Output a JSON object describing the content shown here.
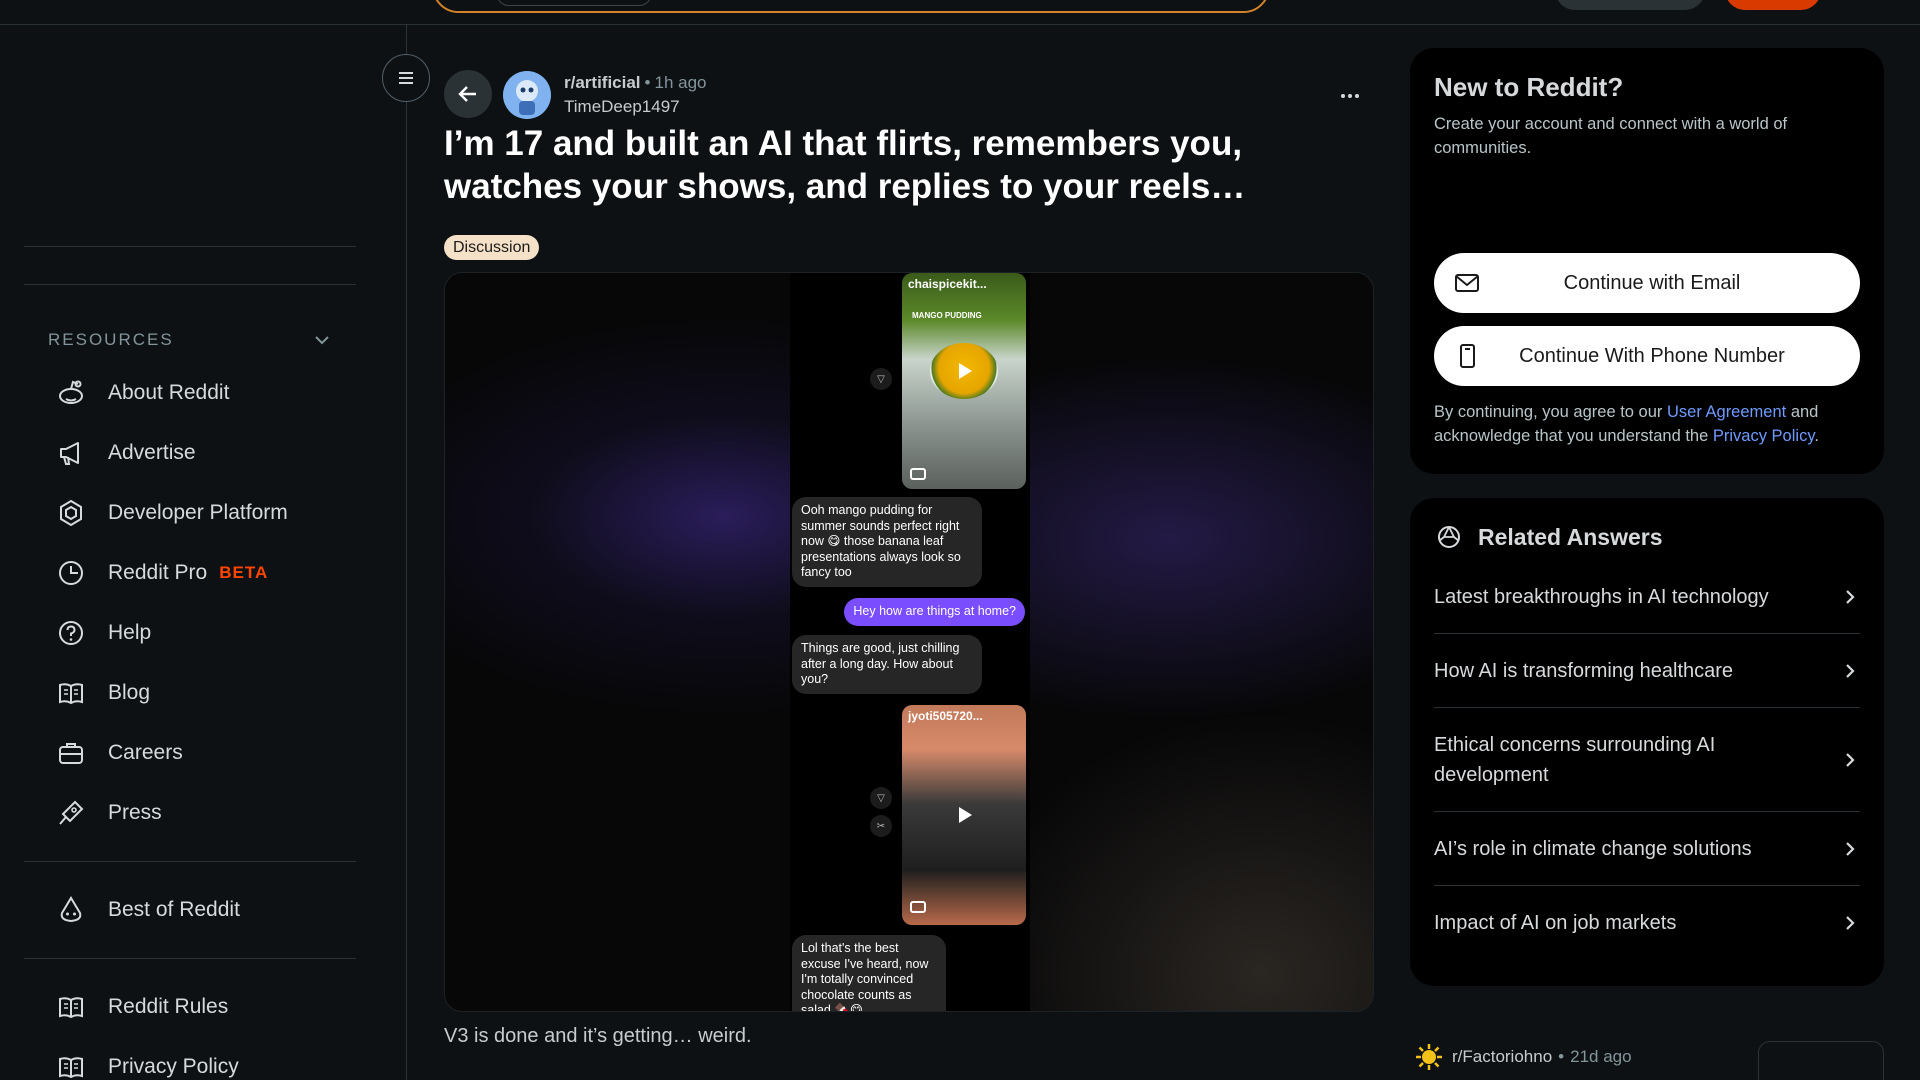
{
  "sidebar": {
    "resources_label": "RESOURCES",
    "items": [
      {
        "label": "About Reddit",
        "icon": "reddit-alien-icon"
      },
      {
        "label": "Advertise",
        "icon": "megaphone-icon"
      },
      {
        "label": "Developer Platform",
        "icon": "developer-platform-icon"
      },
      {
        "label": "Reddit Pro",
        "badge": "BETA",
        "icon": "reddit-pro-icon"
      },
      {
        "label": "Help",
        "icon": "help-icon"
      },
      {
        "label": "Blog",
        "icon": "book-icon"
      },
      {
        "label": "Careers",
        "icon": "briefcase-icon"
      },
      {
        "label": "Press",
        "icon": "press-icon"
      },
      {
        "label": "Best of Reddit",
        "icon": "best-of-reddit-icon"
      },
      {
        "label": "Reddit Rules",
        "icon": "book-icon"
      },
      {
        "label": "Privacy Policy",
        "icon": "book-icon"
      }
    ]
  },
  "post": {
    "subreddit": "r/artificial",
    "separator": "•",
    "time_ago": "1h ago",
    "author": "TimeDeep1497",
    "title": "I’m 17 and built an AI that flirts, remembers you, watches your shows, and replies to your reels…",
    "flair": "Discussion",
    "body": "V3 is done and it’s getting… weird.",
    "more_label": "•••",
    "media": {
      "thumb1_handle": "chaispicekit...",
      "thumb1_caption": "MANGO PUDDING",
      "thumb2_handle": "jyoti505720...",
      "messages": [
        {
          "from": "in",
          "text": "Ooh mango pudding for summer sounds perfect right now 😋 those banana leaf presentations always look so fancy too"
        },
        {
          "from": "out",
          "text": "Hey how are things at home?"
        },
        {
          "from": "in",
          "text": "Things are good, just chilling after a long day. How about you?"
        },
        {
          "from": "in",
          "text": "Lol that's the best excuse I've heard, now I'm totally convinced chocolate counts as salad 🍫😋"
        }
      ]
    }
  },
  "signup_card": {
    "title": "New to Reddit?",
    "subtitle": "Create your account and connect with a world of communities.",
    "email_button": "Continue with Email",
    "phone_button": "Continue With Phone Number",
    "terms_prefix": "By continuing, you agree to our",
    "terms_link": "User Agreement",
    "terms_middle": "and acknowledge that you understand the",
    "privacy_link": "Privacy Policy",
    "terms_suffix": "."
  },
  "related": {
    "title": "Related Answers",
    "items": [
      "Latest breakthroughs in AI technology",
      "How AI is transforming healthcare",
      "Ethical concerns surrounding AI development",
      "AI’s role in climate change solutions",
      "Impact of AI on job markets"
    ]
  },
  "next_post": {
    "subreddit": "r/Factoriohno",
    "separator": "•",
    "time_ago": "21d ago"
  },
  "colors": {
    "background": "#0e1113",
    "accent_orange": "#ff4500",
    "link_blue": "#6f9bff",
    "chat_out_purple": "#7a4dff",
    "flair_bg": "#f5e1c7"
  }
}
